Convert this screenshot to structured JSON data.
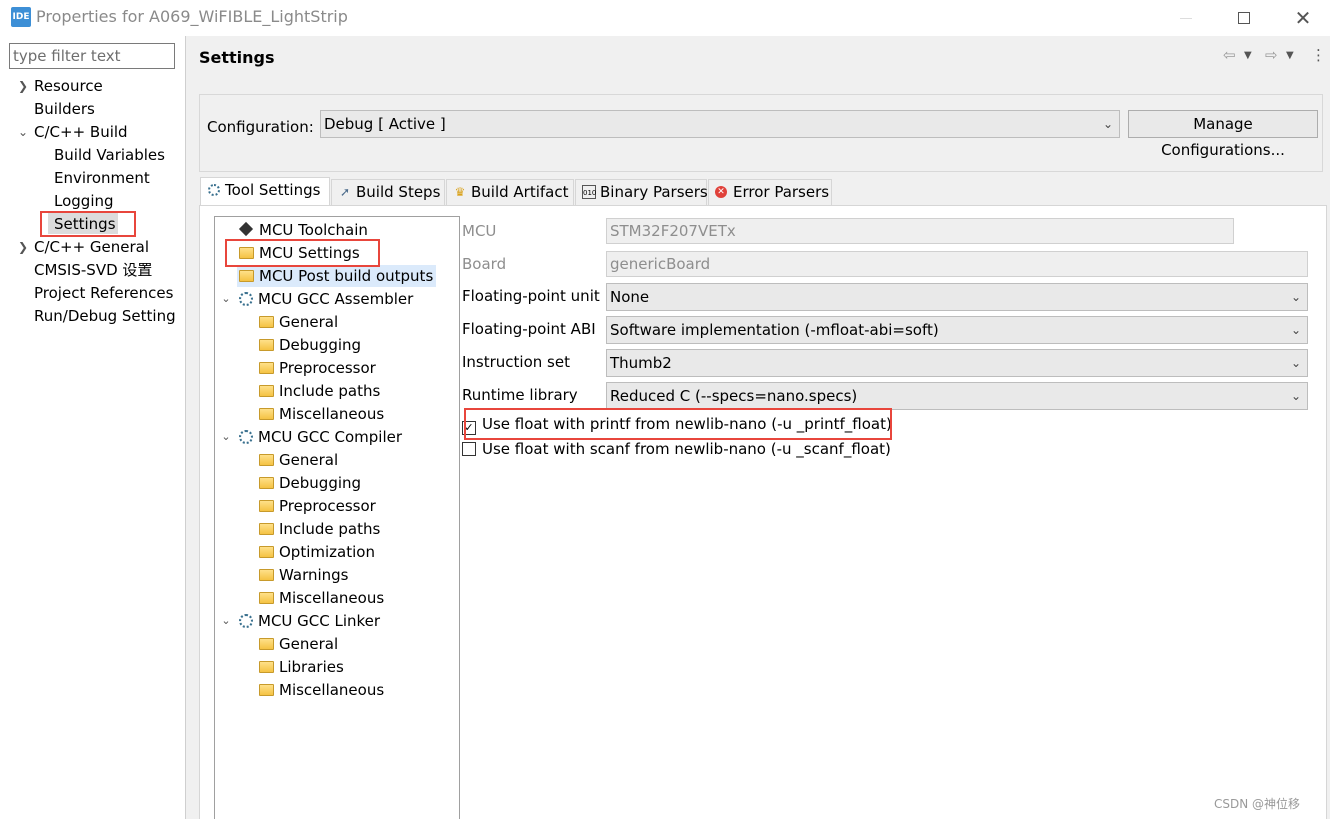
{
  "window": {
    "app_icon_text": "IDE",
    "title": "Properties for A069_WiFIBLE_LightStrip",
    "close_symbol": "✕"
  },
  "left_panel": {
    "filter_placeholder": "type filter text",
    "items": [
      {
        "label": "Resource",
        "expandable": true,
        "expanded": false
      },
      {
        "label": "Builders"
      },
      {
        "label": "C/C++ Build",
        "expandable": true,
        "expanded": true
      },
      {
        "label": "Build Variables"
      },
      {
        "label": "Environment"
      },
      {
        "label": "Logging"
      },
      {
        "label": "Settings",
        "selected": true
      },
      {
        "label": "C/C++ General",
        "expandable": true,
        "expanded": false
      },
      {
        "label": "CMSIS-SVD 设置"
      },
      {
        "label": "Project References"
      },
      {
        "label": "Run/Debug Setting"
      }
    ]
  },
  "main": {
    "title": "Settings",
    "configuration_label": "Configuration:",
    "configuration_value": "Debug  [ Active ]",
    "manage_button": "Manage Configurations...",
    "tabs": [
      {
        "label": "Tool Settings",
        "active": true,
        "icon": "gear-icon"
      },
      {
        "label": "Build Steps",
        "icon": "hammer-icon"
      },
      {
        "label": "Build Artifact",
        "icon": "trophy-icon"
      },
      {
        "label": "Binary Parsers",
        "icon": "binary-icon"
      },
      {
        "label": "Error Parsers",
        "icon": "error-icon"
      }
    ]
  },
  "tree": {
    "items": [
      {
        "label": "MCU Toolchain",
        "icon": "chip-icon"
      },
      {
        "label": "MCU Settings",
        "icon": "folder-icon",
        "selected": true
      },
      {
        "label": "MCU Post build outputs",
        "icon": "folder-icon",
        "highlighted": true
      },
      {
        "label": "MCU GCC Assembler",
        "icon": "gear-icon",
        "expanded": true
      },
      {
        "label": "General",
        "icon": "folder-icon"
      },
      {
        "label": "Debugging",
        "icon": "folder-icon"
      },
      {
        "label": "Preprocessor",
        "icon": "folder-icon"
      },
      {
        "label": "Include paths",
        "icon": "folder-icon"
      },
      {
        "label": "Miscellaneous",
        "icon": "folder-icon"
      },
      {
        "label": "MCU GCC Compiler",
        "icon": "gear-icon",
        "expanded": true
      },
      {
        "label": "General",
        "icon": "folder-icon"
      },
      {
        "label": "Debugging",
        "icon": "folder-icon"
      },
      {
        "label": "Preprocessor",
        "icon": "folder-icon"
      },
      {
        "label": "Include paths",
        "icon": "folder-icon"
      },
      {
        "label": "Optimization",
        "icon": "folder-icon"
      },
      {
        "label": "Warnings",
        "icon": "folder-icon"
      },
      {
        "label": "Miscellaneous",
        "icon": "folder-icon"
      },
      {
        "label": "MCU GCC Linker",
        "icon": "gear-icon",
        "expanded": true
      },
      {
        "label": "General",
        "icon": "folder-icon"
      },
      {
        "label": "Libraries",
        "icon": "folder-icon"
      },
      {
        "label": "Miscellaneous",
        "icon": "folder-icon"
      }
    ]
  },
  "form": {
    "mcu_label": "MCU",
    "mcu_value": "STM32F207VETx",
    "board_label": "Board",
    "board_value": "genericBoard",
    "fpu_label": "Floating-point unit",
    "fpu_value": "None",
    "fpabi_label": "Floating-point ABI",
    "fpabi_value": "Software implementation (-mfloat-abi=soft)",
    "iset_label": "Instruction set",
    "iset_value": "Thumb2",
    "runtime_label": "Runtime library",
    "runtime_value": "Reduced C (--specs=nano.specs)",
    "printf_float_label": "Use float with printf from newlib-nano (-u _printf_float)",
    "printf_float_checked": true,
    "scanf_float_label": "Use float with scanf from newlib-nano (-u _scanf_float)",
    "scanf_float_checked": false
  },
  "watermark": "CSDN @神位移",
  "colors": {
    "highlight_box": "#e8463c",
    "selection": "#dbeafb"
  }
}
